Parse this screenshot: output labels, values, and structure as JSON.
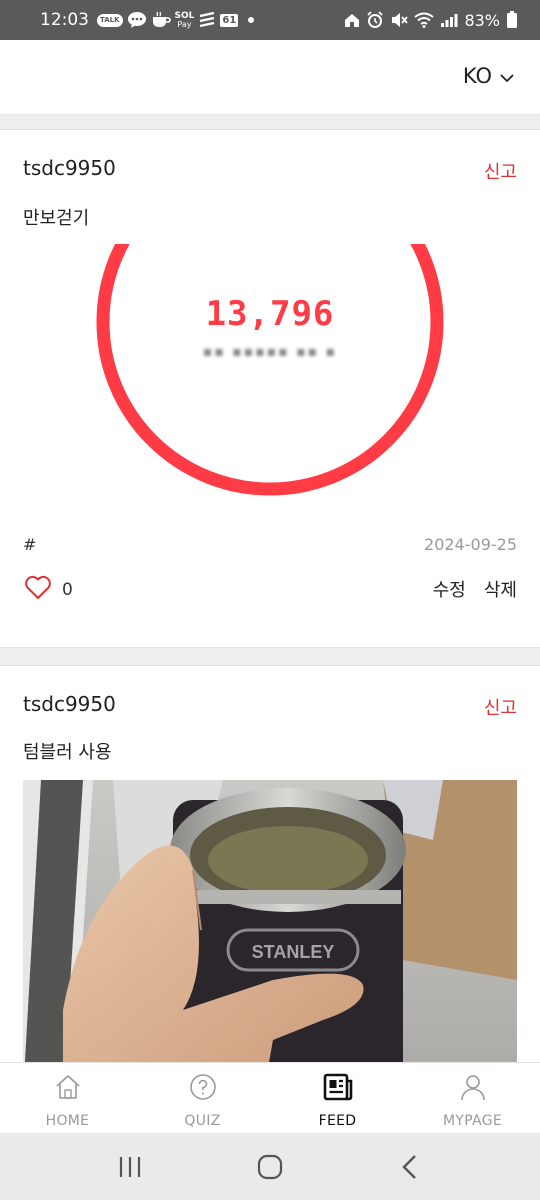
{
  "status_bar": {
    "time": "12:03",
    "talk_badge": "TALK",
    "pay_label": "Pay",
    "badge_61": "61",
    "battery": "83%"
  },
  "header": {
    "language": "KO"
  },
  "posts": [
    {
      "username": "tsdc9950",
      "report_label": "신고",
      "title": "만보걷기",
      "image": {
        "steps": "13,796"
      },
      "hashtag": "#",
      "date": "2024-09-25",
      "likes": "0",
      "edit_label": "수정",
      "delete_label": "삭제"
    },
    {
      "username": "tsdc9950",
      "report_label": "신고",
      "title": "텀블러 사용"
    }
  ],
  "bottom_nav": {
    "items": [
      {
        "label": "HOME",
        "icon": "home-icon"
      },
      {
        "label": "QUIZ",
        "icon": "quiz-icon"
      },
      {
        "label": "FEED",
        "icon": "feed-icon",
        "active": true
      },
      {
        "label": "MYPAGE",
        "icon": "user-icon"
      }
    ]
  },
  "colors": {
    "accent_red": "#e0302f",
    "ring_red": "#ff3b45",
    "status_bar": "#5a5a5a"
  }
}
